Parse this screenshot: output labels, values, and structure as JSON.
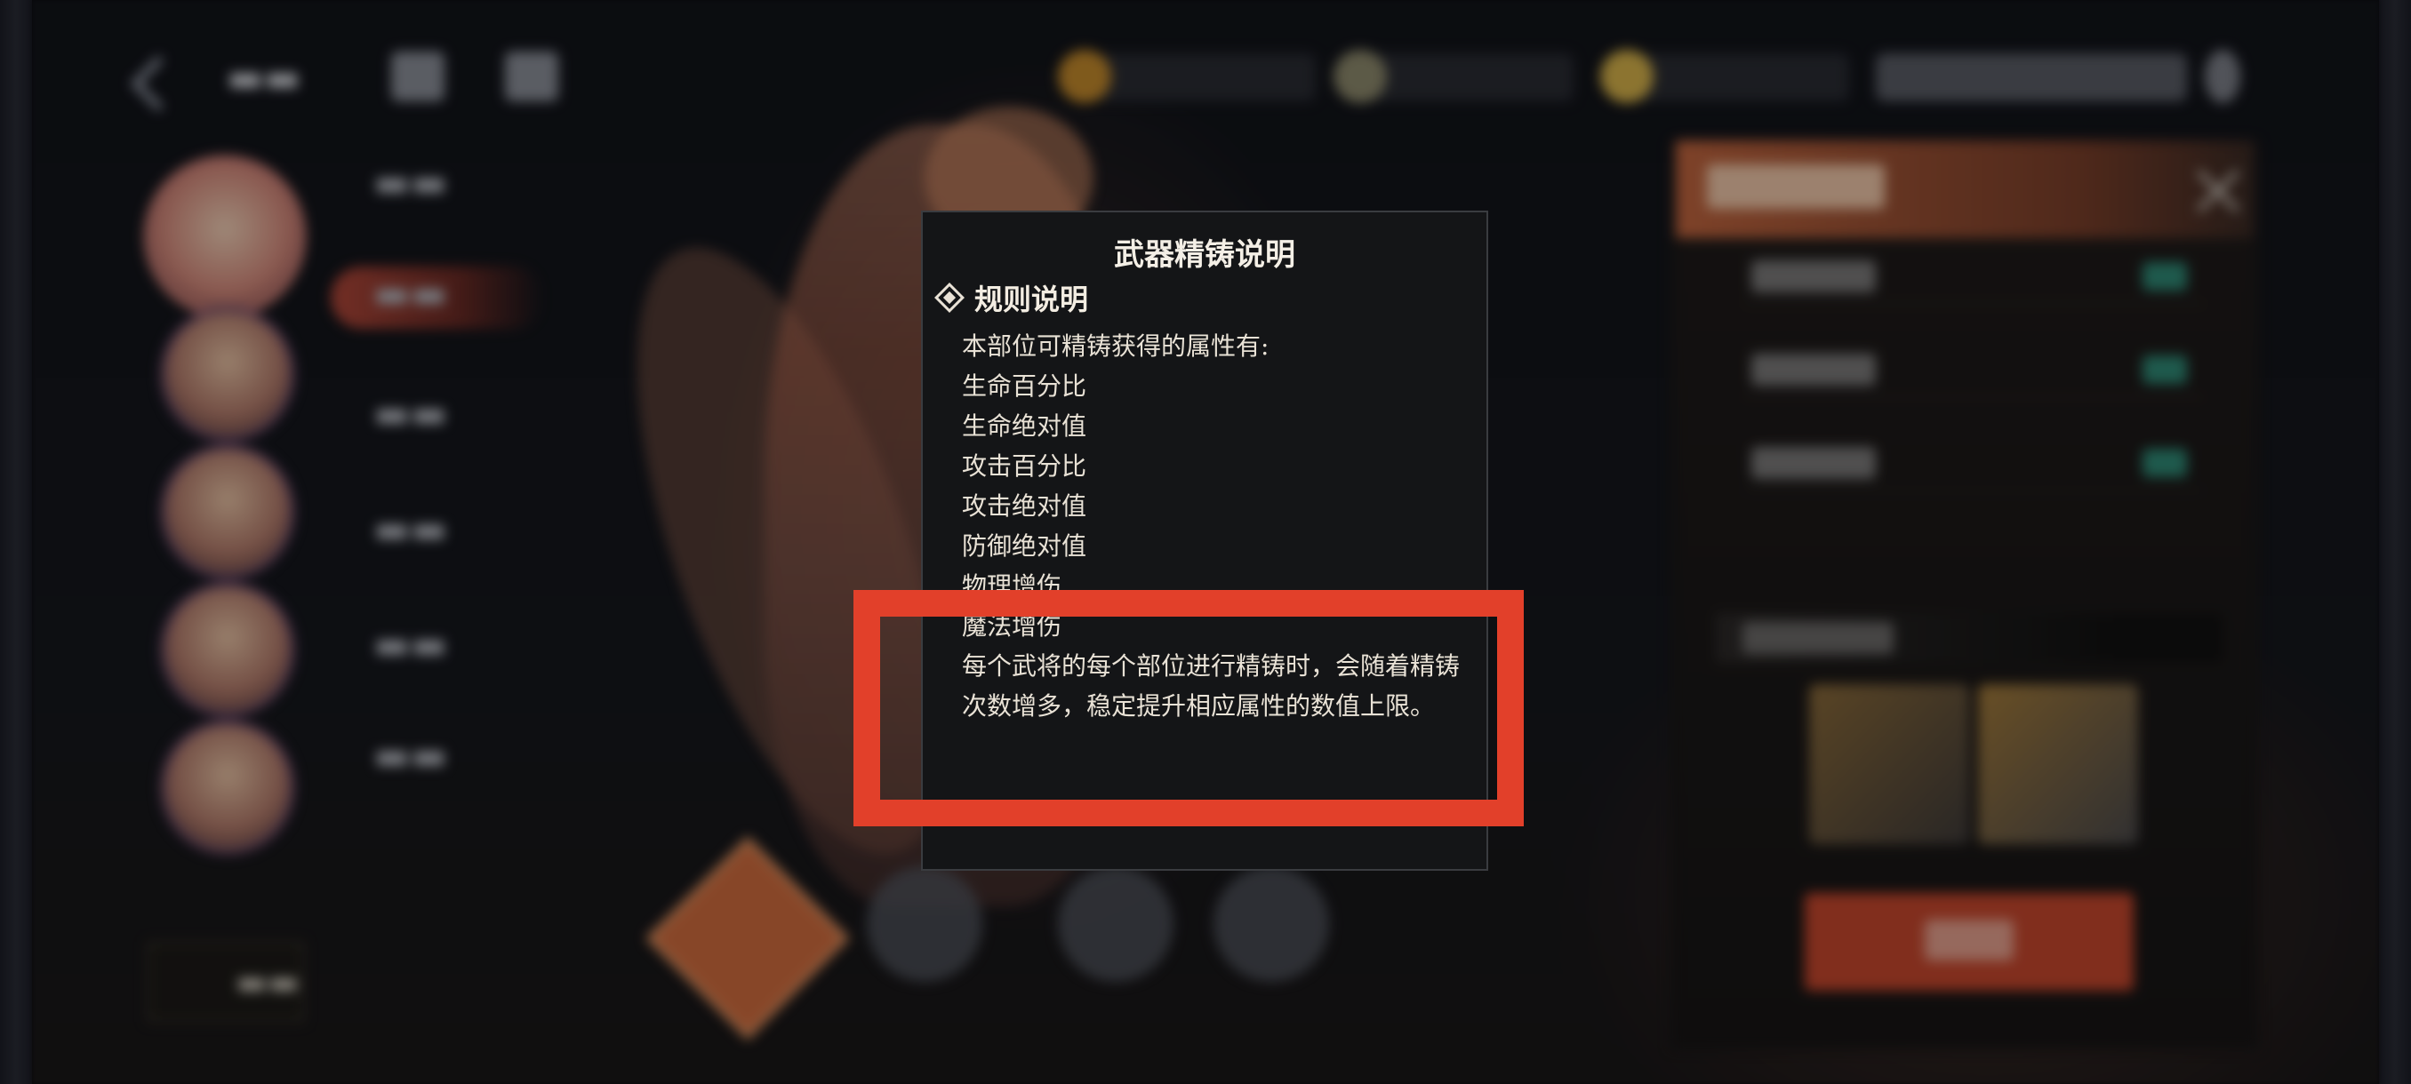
{
  "dialog": {
    "title": "武器精铸说明",
    "section_label": "规则说明",
    "intro": "本部位可精铸获得的属性有:",
    "attributes": [
      "生命百分比",
      "生命绝对值",
      "攻击百分比",
      "攻击绝对值",
      "防御绝对值",
      "物理增伤",
      "魔法增伤"
    ],
    "note": "每个武将的每个部位进行精铸时，会随着精铸次数增多，稳定提升相应属性的数值上限。"
  },
  "highlight_color": "#e2402a",
  "accent_color": "#c6472d",
  "icons": {
    "section": "diamond-bullet-icon",
    "back": "back-arrow-icon",
    "close": "close-icon"
  }
}
